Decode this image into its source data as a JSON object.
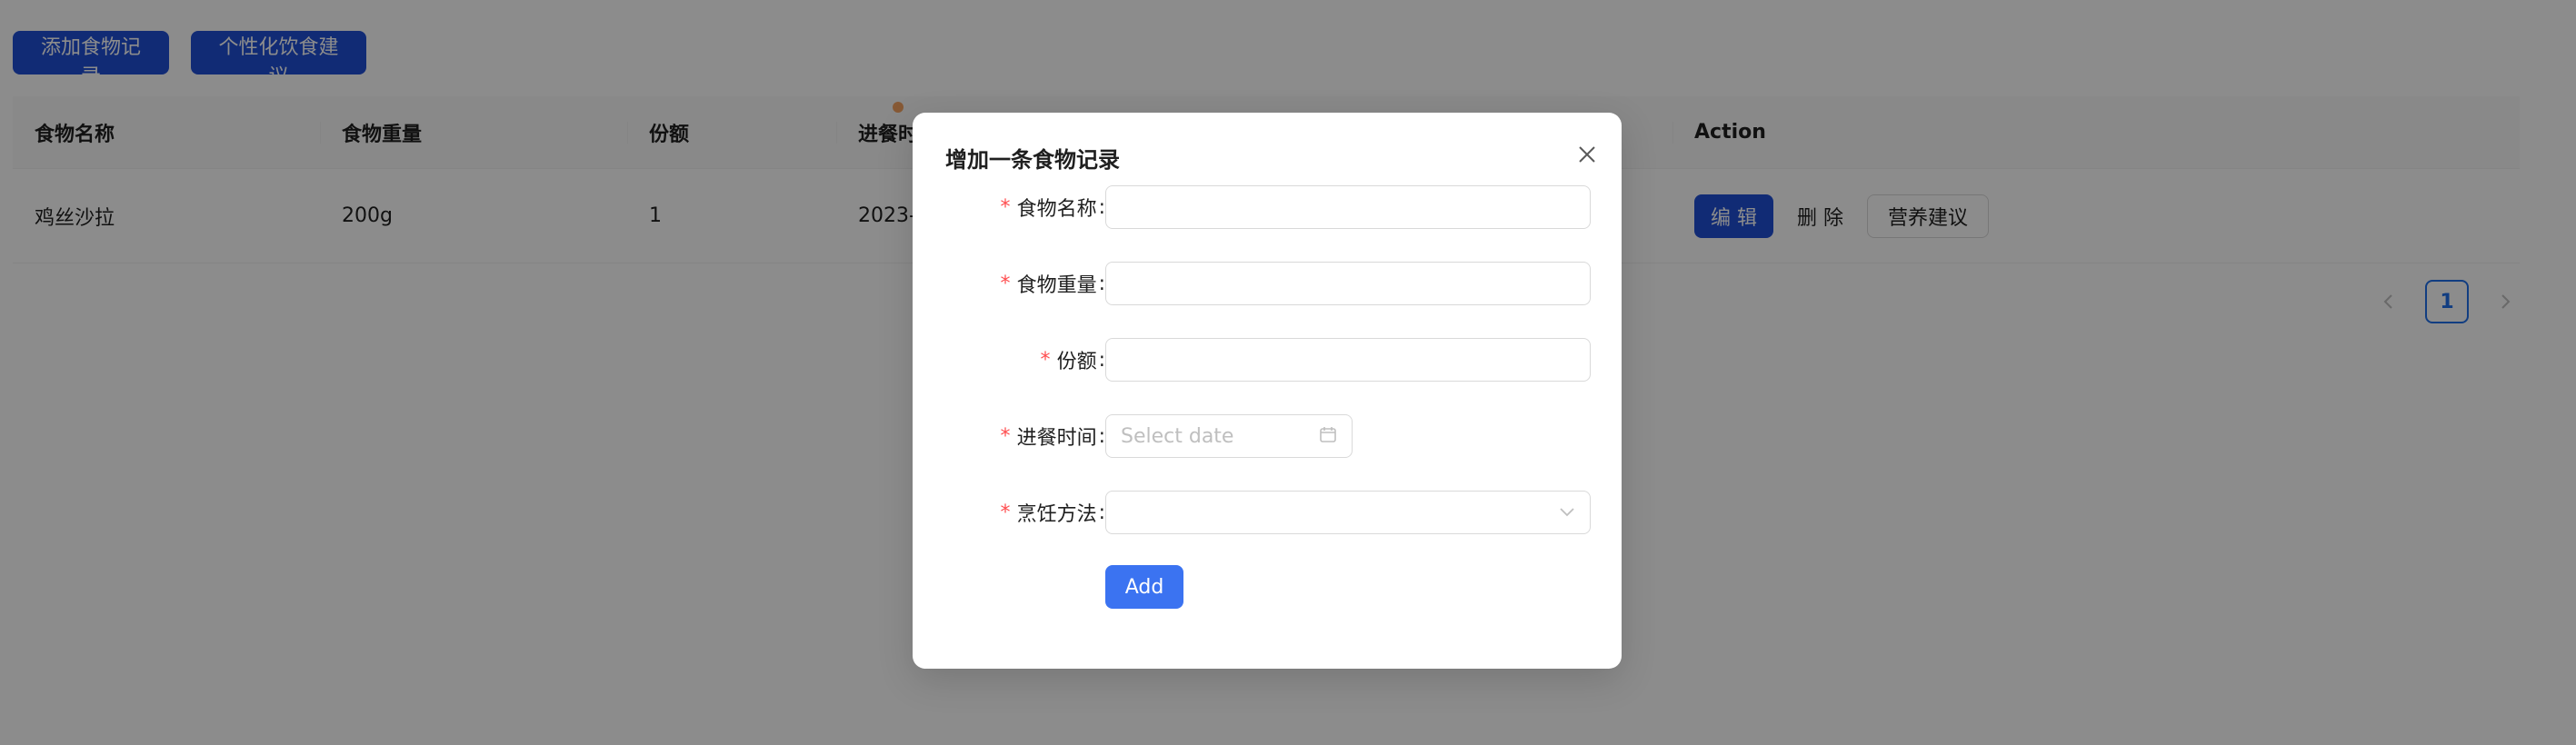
{
  "toolbar": {
    "add_record_label": "添加食物记录",
    "diet_advice_label": "个性化饮食建议"
  },
  "table": {
    "columns": [
      "食物名称",
      "食物重量",
      "份额",
      "进餐时",
      "",
      "Action"
    ],
    "rows": [
      {
        "name": "鸡丝沙拉",
        "weight": "200g",
        "portion": "1",
        "meal_time": "2023-",
        "cooking": ""
      }
    ],
    "actions": {
      "edit": "编 辑",
      "delete": "删 除",
      "advice": "营养建议"
    }
  },
  "pagination": {
    "current_page": "1",
    "prev_icon": "chevron-left-icon",
    "next_icon": "chevron-right-icon"
  },
  "modal": {
    "title": "增加一条食物记录",
    "fields": {
      "food_name": {
        "label": "食物名称",
        "value": ""
      },
      "food_weight": {
        "label": "食物重量",
        "value": ""
      },
      "portion": {
        "label": "份额",
        "value": ""
      },
      "meal_time": {
        "label": "进餐时间",
        "placeholder": "Select date"
      },
      "cooking_method": {
        "label": "烹饪方法",
        "value": ""
      }
    },
    "required_mark": "*",
    "colon": ":",
    "submit_label": "Add"
  },
  "colors": {
    "primary_dark": "#1f4fd6",
    "primary": "#3b73f1",
    "required": "#ff4d4f",
    "mask": "rgba(0,0,0,0.45)"
  }
}
